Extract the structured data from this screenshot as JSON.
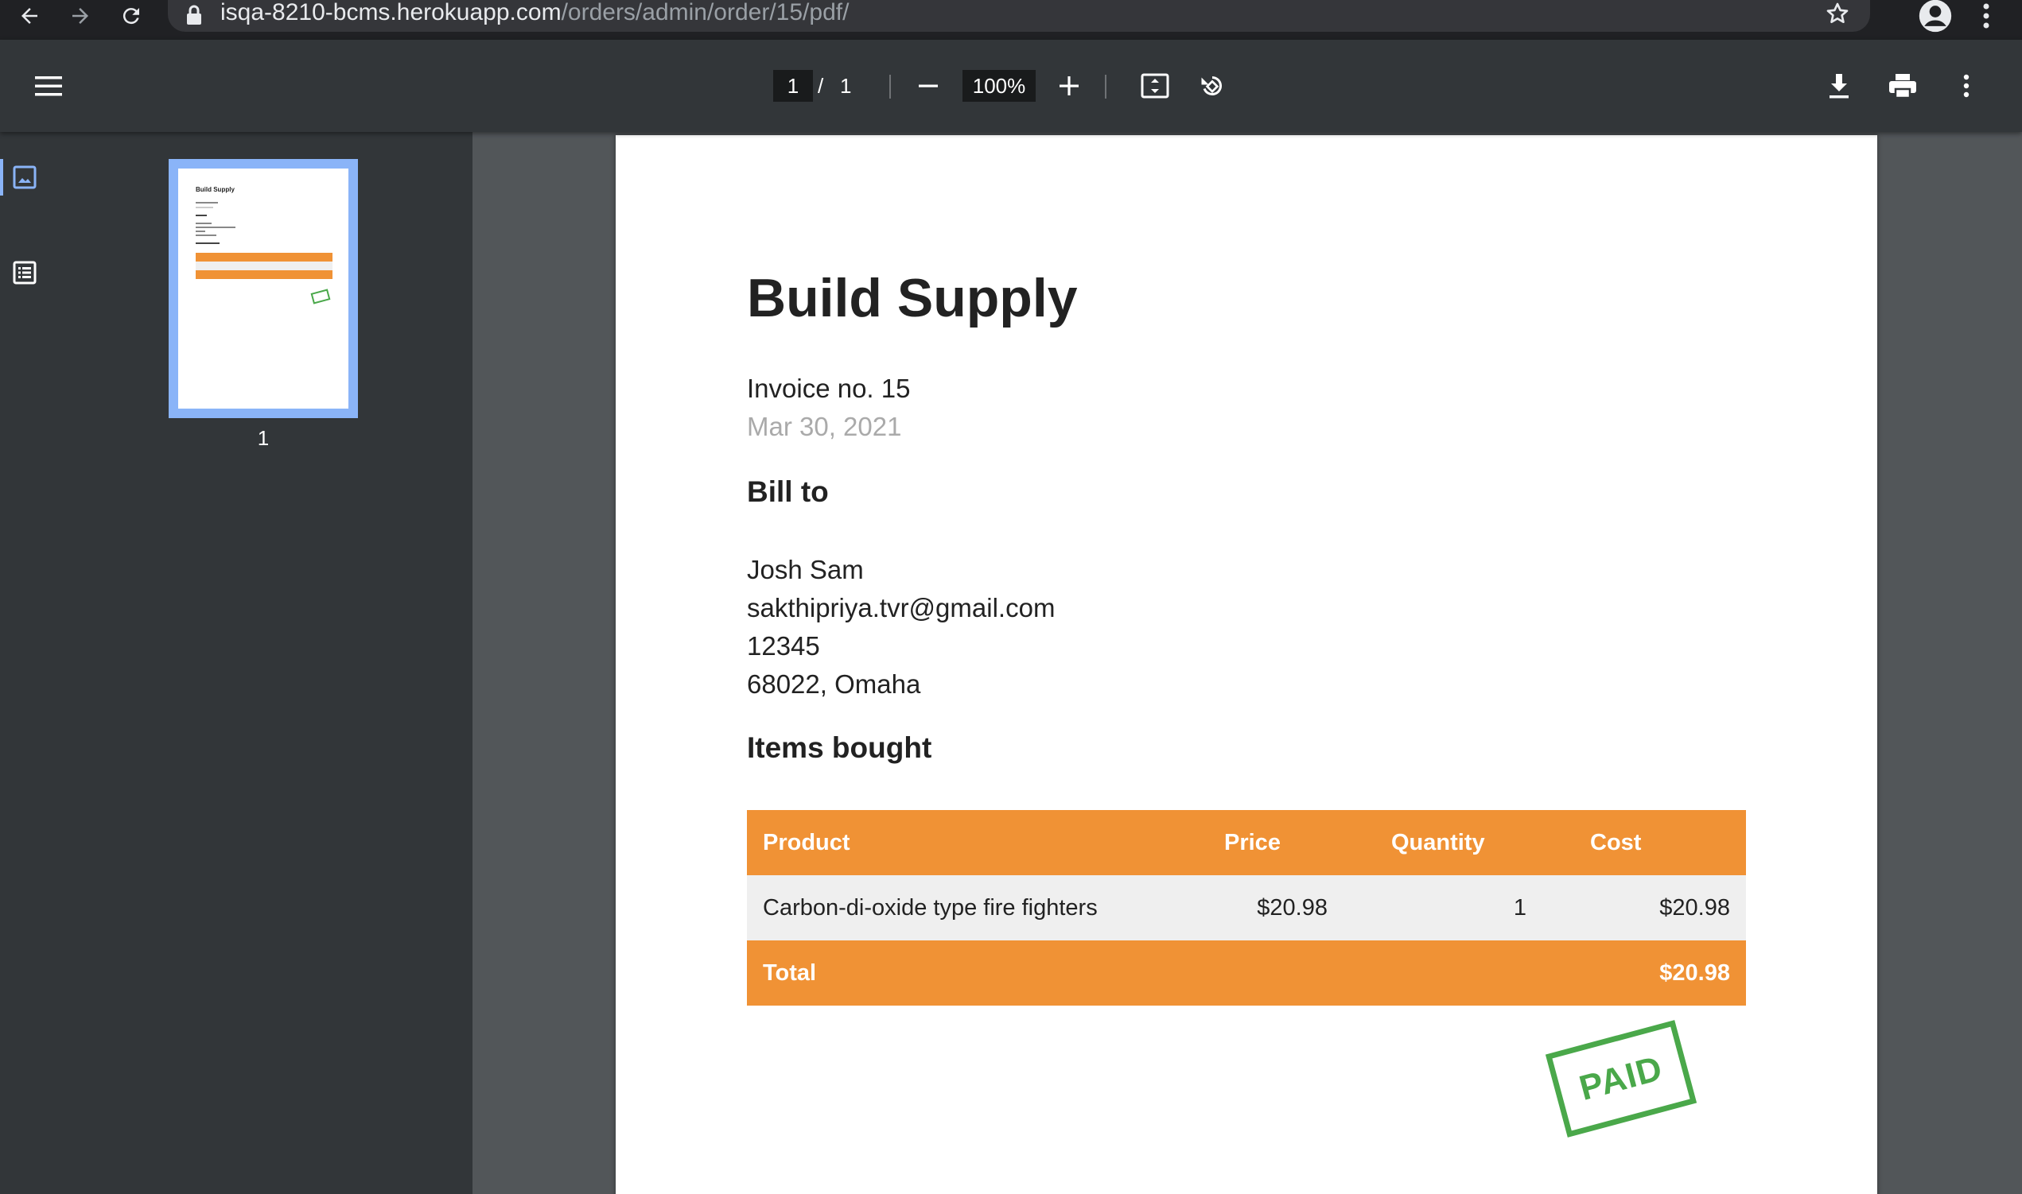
{
  "browser": {
    "url_host": "isqa-8210-bcms.herokuapp.com",
    "url_path": "/orders/admin/order/15/pdf/"
  },
  "toolbar": {
    "current_page": "1",
    "page_separator": "/",
    "total_pages": "1",
    "zoom": "100%"
  },
  "sidebar": {
    "thumbnail_page_number": "1",
    "thumbnail_title": "Build Supply"
  },
  "document": {
    "title": "Build Supply",
    "invoice_number": "Invoice no. 15",
    "date": "Mar 30, 2021",
    "bill_to_heading": "Bill to",
    "bill_to": {
      "name": "Josh Sam",
      "email": "sakthipriya.tvr@gmail.com",
      "phone": "12345",
      "address": "68022, Omaha"
    },
    "items_heading": "Items bought",
    "table": {
      "headers": [
        "Product",
        "Price",
        "Quantity",
        "Cost"
      ],
      "rows": [
        {
          "product": "Carbon-di-oxide type fire fighters",
          "price": "$20.98",
          "quantity": "1",
          "cost": "$20.98"
        }
      ],
      "total_label": "Total",
      "total_value": "$20.98"
    },
    "stamp": "PAID"
  },
  "colors": {
    "accent_orange": "#f09235",
    "stamp_green": "#4aa84a",
    "thumbnail_highlight": "#8ab4f8"
  },
  "icons": {
    "back": "arrow-left-icon",
    "forward": "arrow-right-icon",
    "reload": "reload-icon",
    "lock": "lock-icon",
    "star": "star-icon",
    "profile": "account-circle-icon",
    "browser_menu": "vertical-dots-icon",
    "pdf_menu": "hamburger-menu-icon",
    "zoom_out": "minus-icon",
    "zoom_in": "plus-icon",
    "fit": "fit-to-page-icon",
    "rotate": "rotate-counterclockwise-icon",
    "download": "download-icon",
    "print": "print-icon",
    "more": "vertical-dots-icon",
    "thumbnails": "image-icon",
    "outline": "list-icon"
  }
}
